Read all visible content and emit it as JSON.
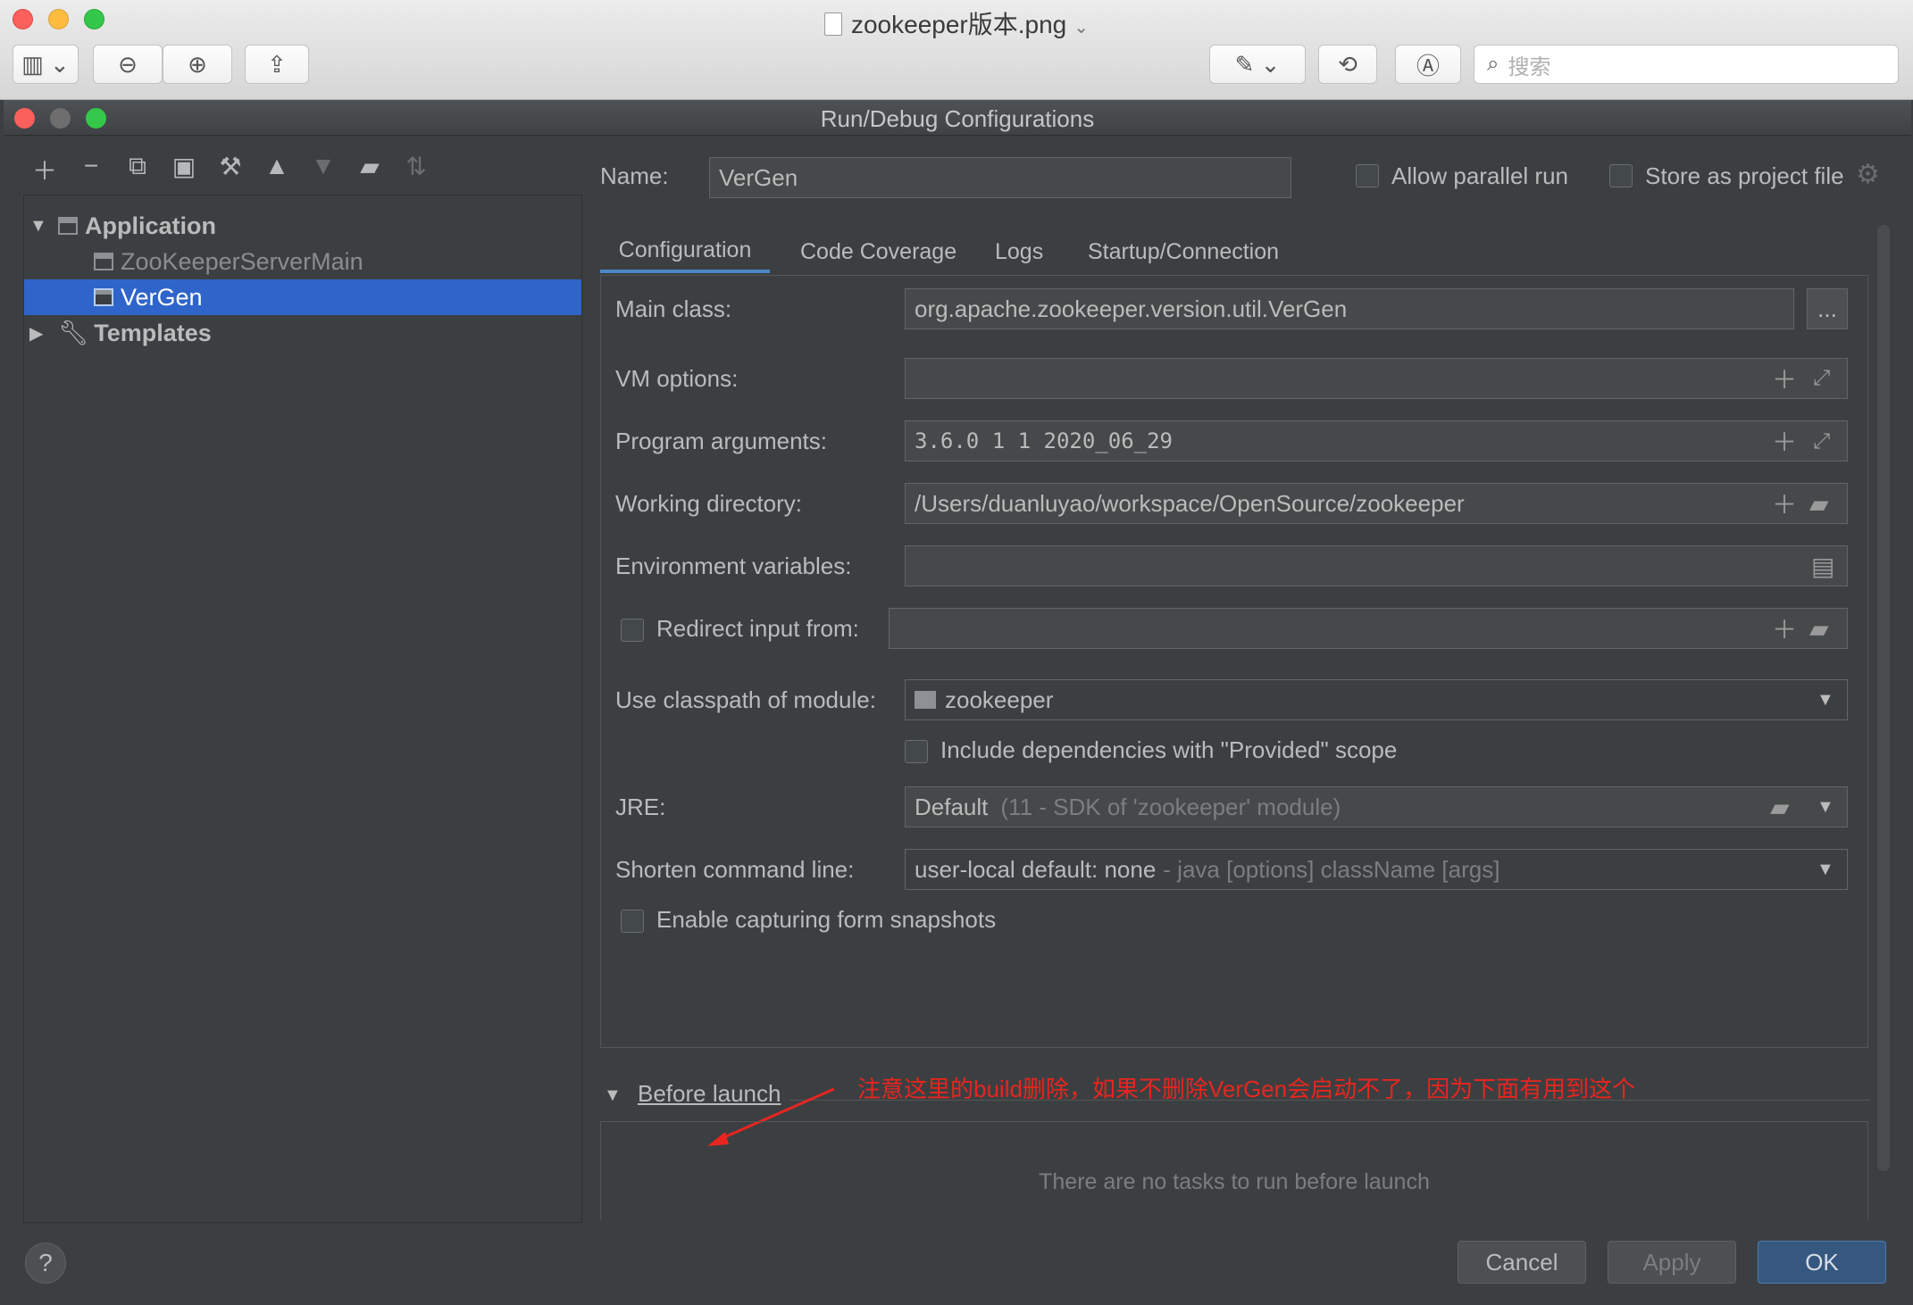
{
  "preview": {
    "title": "zookeeper版本.png",
    "search_placeholder": "搜索"
  },
  "dialog": {
    "title": "Run/Debug Configurations",
    "tree": {
      "application": "Application",
      "items": [
        "ZooKeeperServerMain",
        "VerGen"
      ],
      "templates": "Templates"
    },
    "name_label": "Name:",
    "name_value": "VerGen",
    "allow_parallel": "Allow parallel run",
    "store_project": "Store as project file",
    "tabs": [
      "Configuration",
      "Code Coverage",
      "Logs",
      "Startup/Connection"
    ],
    "main_class_label": "Main class:",
    "main_class_value": "org.apache.zookeeper.version.util.VerGen",
    "browse": "...",
    "vm_options_label": "VM options:",
    "program_args_label": "Program arguments:",
    "program_args_value": "3.6.0 1 1 2020_06_29",
    "working_dir_label": "Working directory:",
    "working_dir_value": "/Users/duanluyao/workspace/OpenSource/zookeeper",
    "env_vars_label": "Environment variables:",
    "redirect_label": "Redirect input from:",
    "classpath_label": "Use classpath of module:",
    "classpath_value": "zookeeper",
    "include_deps": "Include dependencies with \"Provided\" scope",
    "jre_label": "JRE:",
    "jre_value": "Default",
    "jre_hint": "(11 - SDK of 'zookeeper' module)",
    "shorten_label": "Shorten command line:",
    "shorten_value": "user-local default: none",
    "shorten_hint": "- java [options] className [args]",
    "snapshots_label": "Enable capturing form snapshots",
    "before_launch": "Before launch",
    "annotation": "注意这里的build删除，如果不删除VerGen会启动不了，因为下面有用到这个",
    "no_tasks": "There are no tasks to run before launch",
    "help": "?",
    "cancel": "Cancel",
    "apply": "Apply",
    "ok": "OK"
  },
  "colors": {
    "accent": "#2f65ca",
    "annotation": "#e8251f",
    "ok_button": "#365880"
  }
}
